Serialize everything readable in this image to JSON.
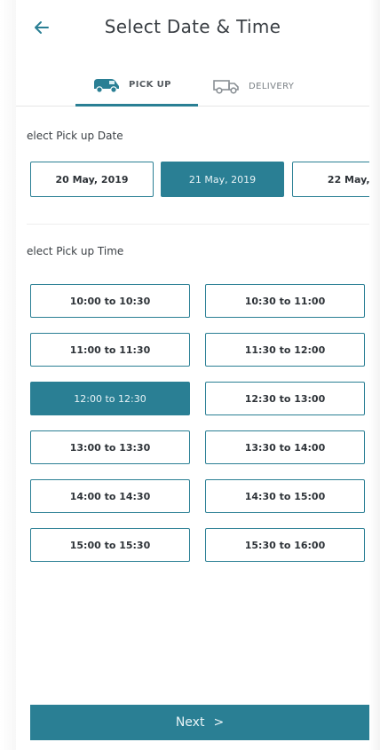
{
  "header": {
    "back_icon": "arrow-left-icon",
    "title": "Select Date & Time"
  },
  "tabs": [
    {
      "label": "PICK UP",
      "icon": "pickup-van-icon",
      "active": true
    },
    {
      "label": "DELIVERY",
      "icon": "delivery-truck-icon",
      "active": false
    }
  ],
  "date_section": {
    "label": "elect Pick up Date",
    "dates": [
      {
        "label": "20 May, 2019",
        "selected": false
      },
      {
        "label": "21 May, 2019",
        "selected": true
      },
      {
        "label": "22 May, 2",
        "selected": false
      }
    ]
  },
  "time_section": {
    "label": "elect Pick up Time",
    "slots": [
      {
        "label": "10:00 to 10:30",
        "selected": false
      },
      {
        "label": "10:30 to 11:00",
        "selected": false
      },
      {
        "label": "11:00 to 11:30",
        "selected": false
      },
      {
        "label": "11:30 to 12:00",
        "selected": false
      },
      {
        "label": "12:00 to 12:30",
        "selected": true
      },
      {
        "label": "12:30 to 13:00",
        "selected": false
      },
      {
        "label": "13:00 to 13:30",
        "selected": false
      },
      {
        "label": "13:30 to 14:00",
        "selected": false
      },
      {
        "label": "14:00 to 14:30",
        "selected": false
      },
      {
        "label": "14:30 to 15:00",
        "selected": false
      },
      {
        "label": "15:00 to 15:30",
        "selected": false
      },
      {
        "label": "15:30 to 16:00",
        "selected": false
      }
    ]
  },
  "footer": {
    "next_label": "Next",
    "next_chevron": ">"
  },
  "colors": {
    "accent": "#2a7f94",
    "text": "#2e3338",
    "divider": "#eeeeee"
  }
}
